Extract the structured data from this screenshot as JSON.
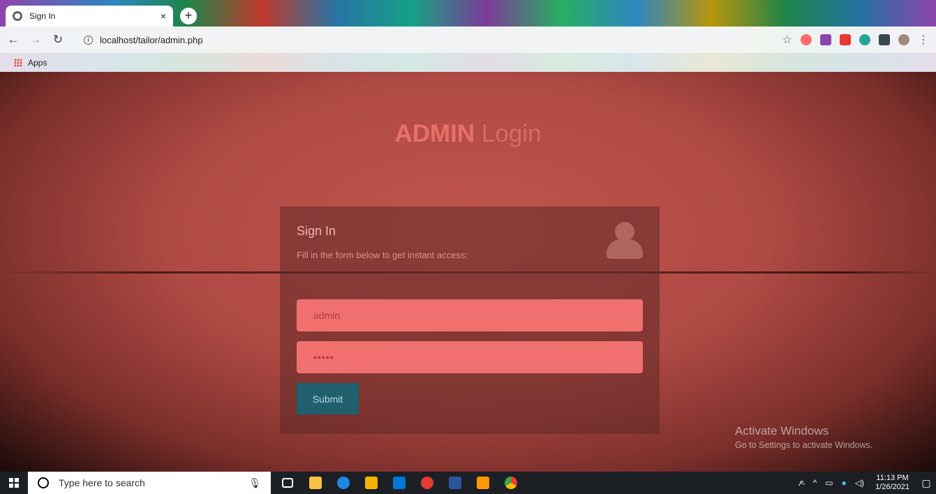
{
  "browser": {
    "tab_title": "Sign In",
    "tab_close": "×",
    "new_tab": "+",
    "url": "localhost/tailor/admin.php",
    "bookmark_apps": "Apps"
  },
  "page": {
    "title_bold": "ADMIN",
    "title_light": "Login",
    "card_title": "Sign In",
    "card_subtitle": "Fill in the form below to get instant access:",
    "username_value": "admin",
    "password_value": "•••••",
    "submit_label": "Submit"
  },
  "watermark": {
    "line1": "Activate Windows",
    "line2": "Go to Settings to activate Windows."
  },
  "taskbar": {
    "search_placeholder": "Type here to search",
    "time": "11:13 PM",
    "date": "1/26/2021",
    "icons": [
      "task-view-icon",
      "file-explorer-icon",
      "edge-icon",
      "store-icon",
      "mail-icon",
      "opera-icon",
      "word-icon",
      "sublime-icon",
      "chrome-icon"
    ]
  },
  "colors": {
    "page_bg": "#b04a44",
    "input_bg": "#f07070",
    "submit_bg": "#1f5f6e",
    "title_color": "#e8706b"
  }
}
